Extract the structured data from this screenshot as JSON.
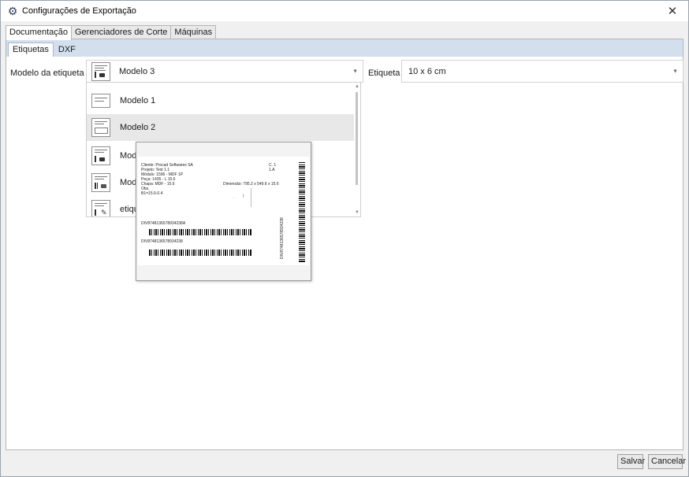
{
  "window": {
    "title": "Configurações de Exportação",
    "icon": "gear-icon"
  },
  "top_tabs": [
    {
      "label": "Documentação",
      "active": true
    },
    {
      "label": "Gerenciadores de Corte",
      "active": false
    },
    {
      "label": "Máquinas",
      "active": false
    }
  ],
  "sub_tabs": [
    {
      "label": "Etiquetas",
      "active": true
    },
    {
      "label": "DXF",
      "active": false
    }
  ],
  "form": {
    "model_label": "Modelo da etiqueta",
    "model_selected": "Modelo 3",
    "etiqueta_label": "Etiqueta",
    "etiqueta_selected": "10 x 6 cm"
  },
  "dropdown": {
    "items": [
      {
        "label": "Modelo 1",
        "icon": "label-model-1-icon"
      },
      {
        "label": "Modelo 2",
        "icon": "label-model-2-icon",
        "hover": true
      },
      {
        "label": "Mod",
        "icon": "label-model-3-icon"
      },
      {
        "label": "Mod",
        "icon": "label-model-4-icon"
      },
      {
        "label": "etiqu",
        "icon": "label-model-edit-icon"
      }
    ]
  },
  "preview": {
    "lines_left": [
      "Cliente: Procad Softwares SA",
      "Projeto: Test 1.1",
      "Módulo: 1596 - MDF 1P",
      "Peça: 1435 - L 15.6",
      "Chapa: MDF - 15.6",
      "Obs.",
      "B1=15.6-0.4"
    ],
    "c_line": "C. 1",
    "a_line": "1.A",
    "dimension": "Dimensão: 795.2 x 549.6 x 15.6",
    "code_a": "DIV8748136578934238A",
    "code_b": "DIV8748136578934238",
    "code_vertical": "DIV8748136578934238"
  },
  "buttons": {
    "save": "Salvar",
    "cancel": "Cancelar"
  },
  "colors": {
    "subtab_strip": "#d4dfee",
    "hover_row": "#e8e8e8"
  }
}
